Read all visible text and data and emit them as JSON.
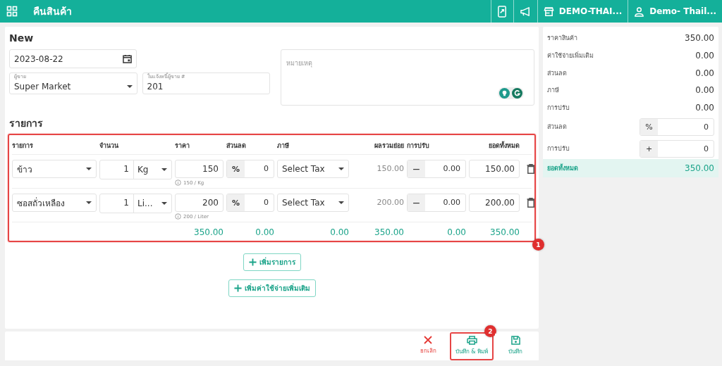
{
  "header": {
    "title": "คืนสินค้า",
    "store": "DEMO-THAI...",
    "user": "Demo- Thail..."
  },
  "form": {
    "heading": "New",
    "date": "2023-08-22",
    "vendor": {
      "label": "ผู้ขาย",
      "value": "Super Market"
    },
    "invoice": {
      "label": "ใบแจ้งหนี้ผู้ขาย #",
      "value": "201"
    },
    "note": {
      "placeholder": "หมายเหตุ"
    }
  },
  "items": {
    "heading": "รายการ",
    "callout": "1",
    "columns": [
      "รายการ",
      "จำนวน",
      "ราคา",
      "ส่วนลด",
      "ภาษี",
      "ผลรวมย่อย",
      "การปรับ",
      "ยอดทั้งหมด"
    ],
    "rows": [
      {
        "name": "ข้าว",
        "qty": "1",
        "unit": "Kg",
        "price": "150",
        "hint": "150 / Kg",
        "discount_type": "%",
        "discount": "0",
        "tax": "Select Tax",
        "subtotal": "150.00",
        "adjust_sign": "−",
        "adjust": "0.00",
        "total": "150.00"
      },
      {
        "name": "ซอสถั่วเหลือง",
        "qty": "1",
        "unit": "Li...",
        "price": "200",
        "hint": "200 / Liter",
        "discount_type": "%",
        "discount": "0",
        "tax": "Select Tax",
        "subtotal": "200.00",
        "adjust_sign": "−",
        "adjust": "0.00",
        "total": "200.00"
      }
    ],
    "totals": {
      "price": "350.00",
      "discount": "0.00",
      "tax": "0.00",
      "subtotal": "350.00",
      "adjust": "0.00",
      "total": "350.00"
    }
  },
  "add_buttons": [
    "เพิ่มรายการ",
    "เพิ่มค่าใช้จ่ายเพิ่มเติม"
  ],
  "summary": {
    "rows": [
      {
        "kind": "text",
        "label": "ราคาสินค้า",
        "value": "350.00"
      },
      {
        "kind": "text",
        "label": "ค่าใช้จ่ายเพิ่มเติม",
        "value": "0.00"
      },
      {
        "kind": "text",
        "label": "ส่วนลด",
        "value": "0.00"
      },
      {
        "kind": "text",
        "label": "ภาษี",
        "value": "0.00"
      },
      {
        "kind": "text",
        "label": "การปรับ",
        "value": "0.00"
      },
      {
        "kind": "input",
        "label": "ส่วนลด",
        "prefix": "%",
        "value": "0"
      },
      {
        "kind": "input",
        "label": "การปรับ",
        "prefix": "+",
        "value": "0"
      }
    ],
    "total": {
      "label": "ยอดทั้งหมด",
      "value": "350.00"
    }
  },
  "actions": [
    {
      "kind": "cancel",
      "label": "ยกเลิก"
    },
    {
      "kind": "print",
      "label": "บันทึก & พิมพ์",
      "callout": "2"
    },
    {
      "kind": "save",
      "label": "บันทึก"
    }
  ]
}
